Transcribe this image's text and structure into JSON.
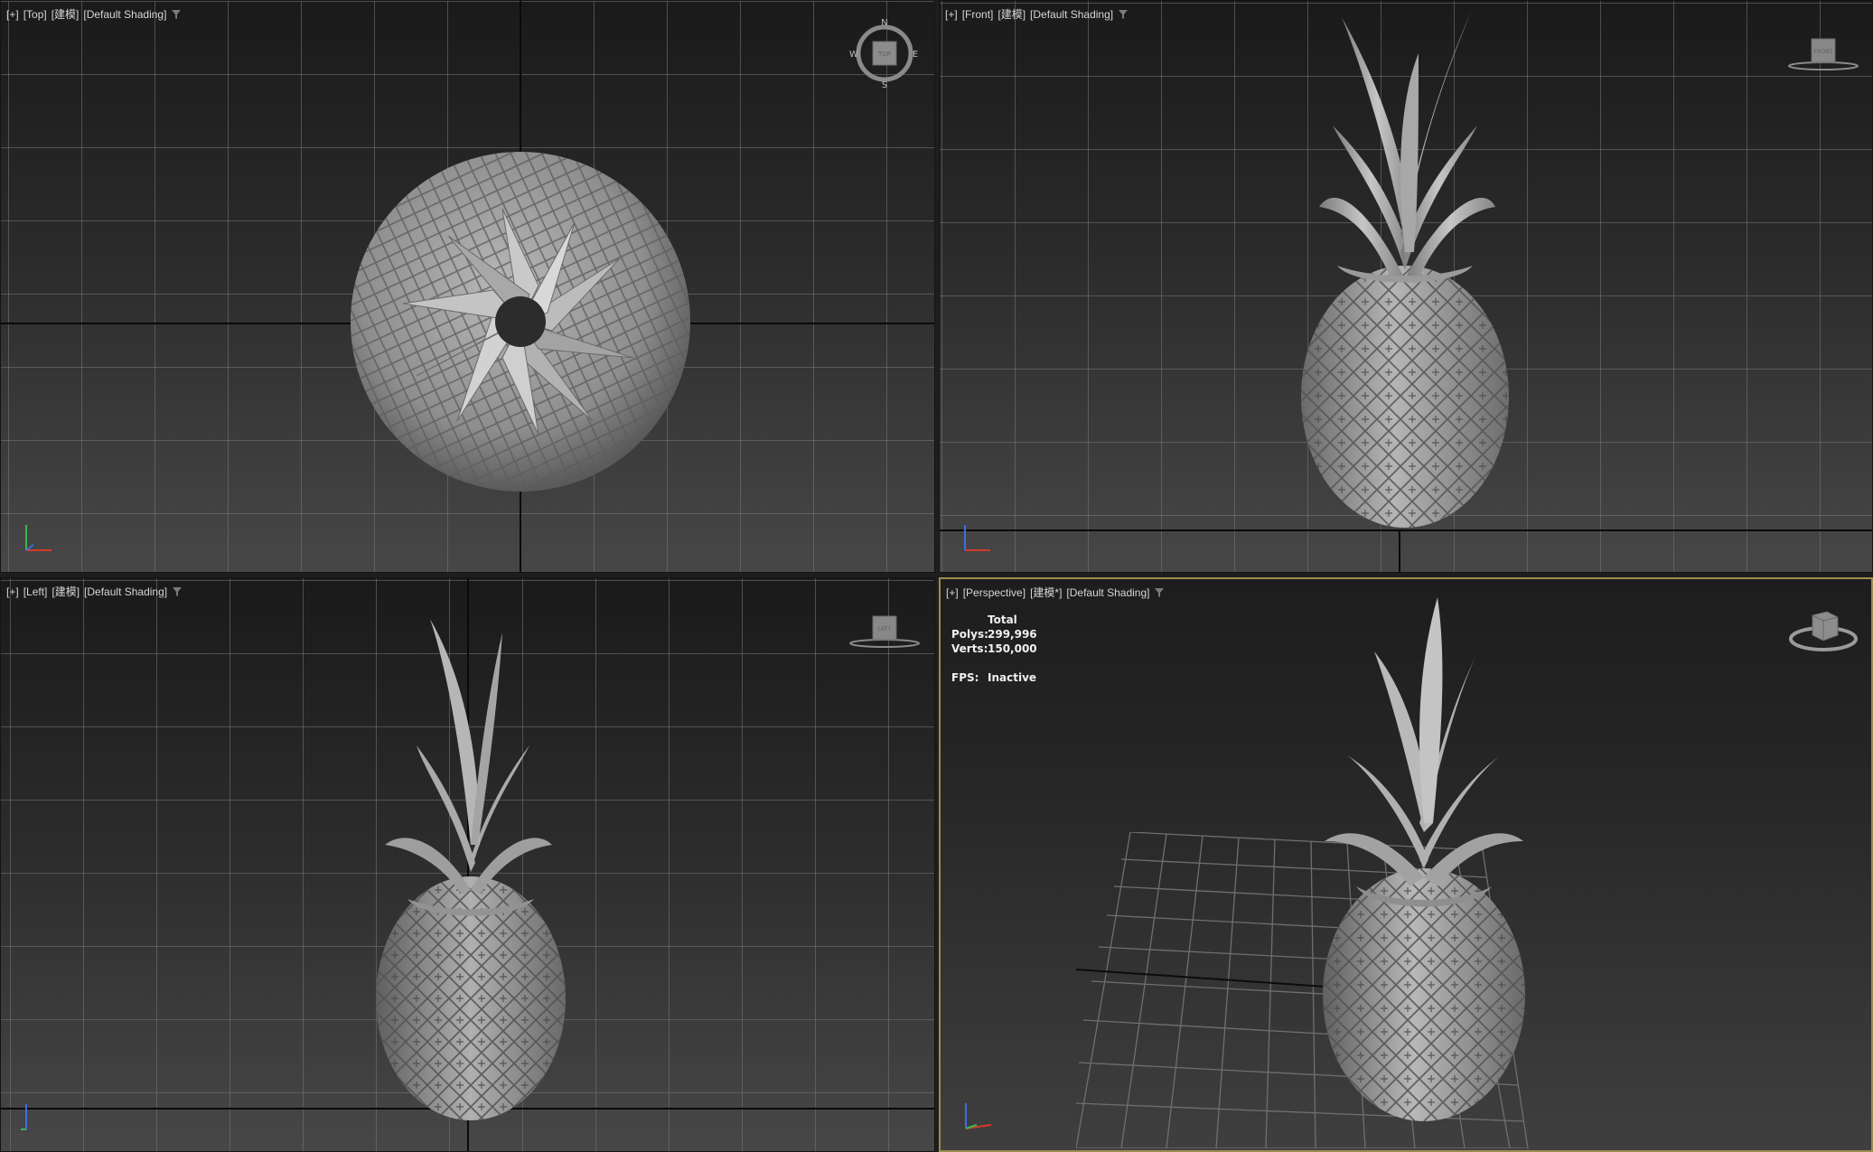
{
  "viewports": {
    "top": {
      "label": [
        "[+]",
        "[Top]",
        "[建模]",
        "[Default Shading]"
      ],
      "compass": {
        "n": "N",
        "s": "S",
        "e": "E",
        "w": "W"
      },
      "viewcube_face": "TOP"
    },
    "front": {
      "label": [
        "[+]",
        "[Front]",
        "[建模]",
        "[Default Shading]"
      ],
      "viewcube_face": "FRONT"
    },
    "left": {
      "label": [
        "[+]",
        "[Left]",
        "[建模]",
        "[Default Shading]"
      ],
      "viewcube_face": "LEFT"
    },
    "perspective": {
      "label": [
        "[+]",
        "[Perspective]",
        "[建模*]",
        "[Default Shading]"
      ],
      "stats": {
        "header": "Total",
        "polys_label": "Polys:",
        "polys_value": "299,996",
        "verts_label": "Verts:",
        "verts_value": "150,000",
        "fps_label": "FPS:",
        "fps_value": "Inactive"
      },
      "active_border_color": "#9b8e4e"
    }
  },
  "icons": {
    "filter": "filter-icon",
    "viewcube": "viewcube-icon",
    "axis": "axis-tripod-icon"
  },
  "colors": {
    "x_axis": "#d33a2c",
    "y_axis": "#3fb34f",
    "z_axis": "#3b6fe0",
    "model": "#9a9a9a"
  }
}
